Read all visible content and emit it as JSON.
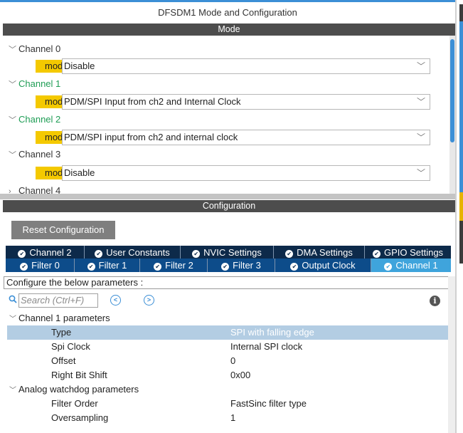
{
  "window": {
    "title": "DFSDM1 Mode and Configuration"
  },
  "mode_section": {
    "header": "Mode",
    "channels": [
      {
        "label": "Channel 0",
        "mode_label": "mode",
        "value": "Disable",
        "active": false
      },
      {
        "label": "Channel 1",
        "mode_label": "mode",
        "value": "PDM/SPI Input from ch2 and Internal Clock",
        "active": true
      },
      {
        "label": "Channel 2",
        "mode_label": "mode",
        "value": "PDM/SPI input from ch2 and internal clock",
        "active": true
      },
      {
        "label": "Channel 3",
        "mode_label": "mode",
        "value": "Disable",
        "active": false
      },
      {
        "label": "Channel 4"
      }
    ]
  },
  "config_section": {
    "header": "Configuration",
    "reset_label": "Reset Configuration",
    "tabs_row1": [
      "Channel 2",
      "User Constants",
      "NVIC Settings",
      "DMA Settings",
      "GPIO Settings"
    ],
    "tabs_row2": [
      "Filter 0",
      "Filter 1",
      "Filter 2",
      "Filter 3",
      "Output Clock",
      "Channel 1"
    ],
    "active_tab": "Channel 1",
    "params_caption": "Configure the below parameters :",
    "search_placeholder": "Search (Ctrl+F)",
    "groups": [
      {
        "label": "Channel 1 parameters",
        "params": [
          {
            "name": "Type",
            "value": "SPI with falling edge",
            "selected": true
          },
          {
            "name": "Spi Clock",
            "value": "Internal SPI clock"
          },
          {
            "name": "Offset",
            "value": "0"
          },
          {
            "name": "Right Bit Shift",
            "value": "0x00"
          }
        ]
      },
      {
        "label": "Analog watchdog parameters",
        "params": [
          {
            "name": "Filter Order",
            "value": "FastSinc filter type"
          },
          {
            "name": "Oversampling",
            "value": "1"
          }
        ]
      }
    ]
  },
  "icons": {
    "expand": "chevron-down-icon",
    "collapsed": "chevron-right-icon",
    "dropdown": "dropdown-arrow-icon",
    "tab_status": "check-circle-icon",
    "search": "search-icon",
    "prev": "previous-match-icon",
    "next": "next-match-icon",
    "info": "info-icon"
  },
  "colors": {
    "accent": "#3c8fd6",
    "mode_label_bg": "#f4c900",
    "active_channel_text": "#1f9d55",
    "tab_row1_bg": "#0d2a4a",
    "tab_row2_bg": "#0d4c8a",
    "tab_active_bg": "#3fa4dc",
    "selected_row_bg": "#b3cde3"
  }
}
